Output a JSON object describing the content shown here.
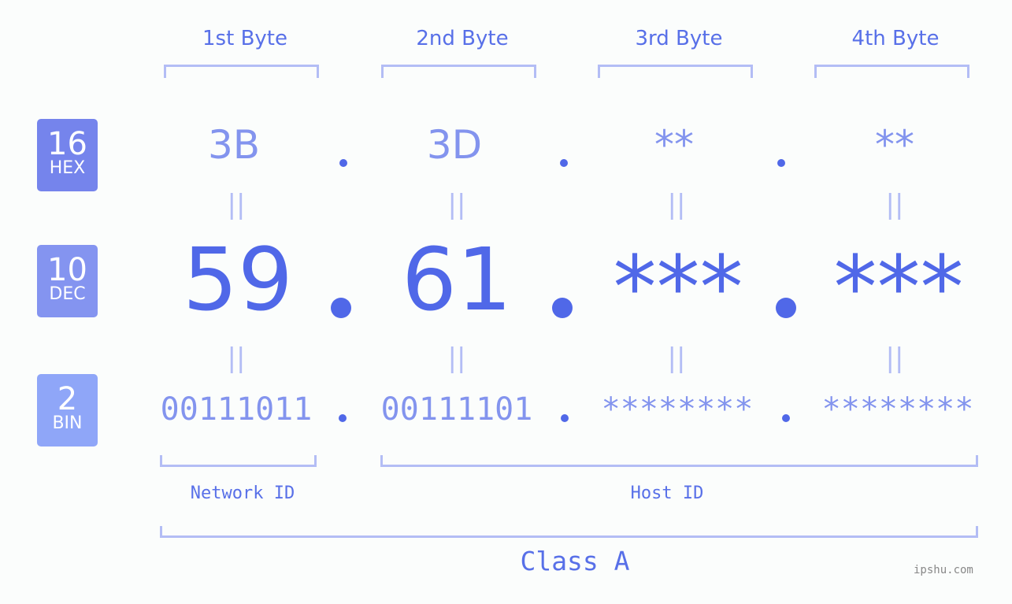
{
  "bytes": [
    {
      "header": "1st Byte",
      "hex": "3B",
      "dec": "59",
      "bin": "00111011"
    },
    {
      "header": "2nd Byte",
      "hex": "3D",
      "dec": "61",
      "bin": "00111101"
    },
    {
      "header": "3rd Byte",
      "hex": "**",
      "dec": "***",
      "bin": "********"
    },
    {
      "header": "4th Byte",
      "hex": "**",
      "dec": "***",
      "bin": "********"
    }
  ],
  "bases": {
    "hex": {
      "number": "16",
      "label": "HEX",
      "color": "#7584ec"
    },
    "dec": {
      "number": "10",
      "label": "DEC",
      "color": "#8494f0"
    },
    "bin": {
      "number": "2",
      "label": "BIN",
      "color": "#8fa6f8"
    }
  },
  "equals_glyph": "||",
  "segments": {
    "network": "Network ID",
    "host": "Host ID",
    "class": "Class A"
  },
  "watermark": "ipshu.com"
}
